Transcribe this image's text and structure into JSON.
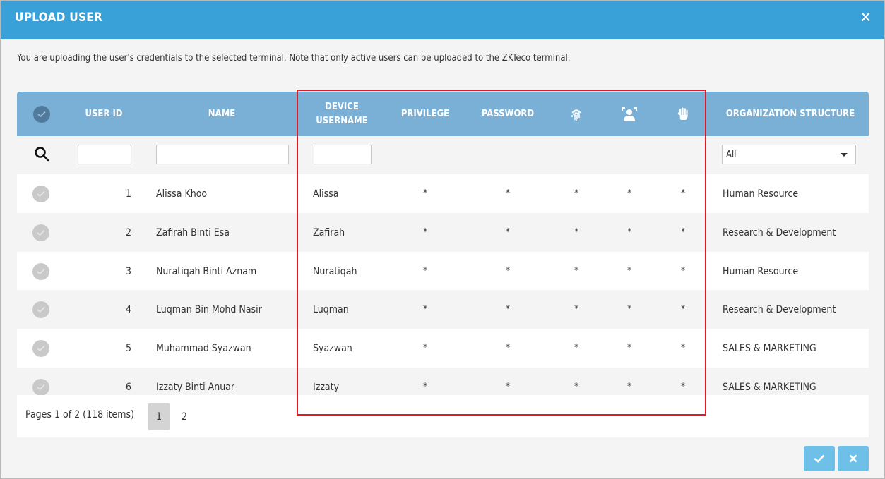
{
  "dialog": {
    "title": "UPLOAD USER",
    "close_label": "✕",
    "notice": "You are uploading the user's credentials to the selected terminal. Note that only active users can be uploaded to the ZKTeco terminal."
  },
  "table": {
    "headers": {
      "user_id": "USER ID",
      "name": "NAME",
      "device_username_line1": "DEVICE",
      "device_username_line2": "USERNAME",
      "privilege": "PRIVILEGE",
      "password": "PASSWORD",
      "fingerprint_icon": "fingerprint-icon",
      "face_icon": "face-icon",
      "palm_icon": "palm-icon",
      "organization_structure": "ORGANIZATION STRUCTURE"
    },
    "filters": {
      "user_id_value": "",
      "name_value": "",
      "device_username_value": "",
      "organization_selected": "All"
    },
    "rows": [
      {
        "id": "1",
        "name": "Alissa Khoo",
        "device_username": "Alissa",
        "privilege": "*",
        "password": "*",
        "fingerprint": "*",
        "face": "*",
        "palm": "*",
        "organization": "Human Resource"
      },
      {
        "id": "2",
        "name": "Zafirah Binti Esa",
        "device_username": "Zafirah",
        "privilege": "*",
        "password": "*",
        "fingerprint": "*",
        "face": "*",
        "palm": "*",
        "organization": "Research & Development"
      },
      {
        "id": "3",
        "name": "Nuratiqah Binti Aznam",
        "device_username": "Nuratiqah",
        "privilege": "*",
        "password": "*",
        "fingerprint": "*",
        "face": "*",
        "palm": "*",
        "organization": "Human Resource"
      },
      {
        "id": "4",
        "name": "Luqman Bin Mohd Nasir",
        "device_username": "Luqman",
        "privilege": "*",
        "password": "*",
        "fingerprint": "*",
        "face": "*",
        "palm": "*",
        "organization": "Research & Development"
      },
      {
        "id": "5",
        "name": "Muhammad Syazwan",
        "device_username": "Syazwan",
        "privilege": "*",
        "password": "*",
        "fingerprint": "*",
        "face": "*",
        "palm": "*",
        "organization": "SALES & MARKETING"
      },
      {
        "id": "6",
        "name": "Izzaty Binti Anuar",
        "device_username": "Izzaty",
        "privilege": "*",
        "password": "*",
        "fingerprint": "*",
        "face": "*",
        "palm": "*",
        "organization": "SALES & MARKETING"
      }
    ]
  },
  "pager": {
    "info": "Pages 1 of 2 (118 items)",
    "pages": [
      "1",
      "2"
    ],
    "active_page": "1"
  },
  "actions": {
    "confirm_icon": "check-icon",
    "cancel_icon": "close-icon"
  },
  "colors": {
    "titlebar": "#3aa0d8",
    "header": "#7aafd6",
    "highlight": "#e01b24",
    "action_button": "#6fc0e8"
  }
}
